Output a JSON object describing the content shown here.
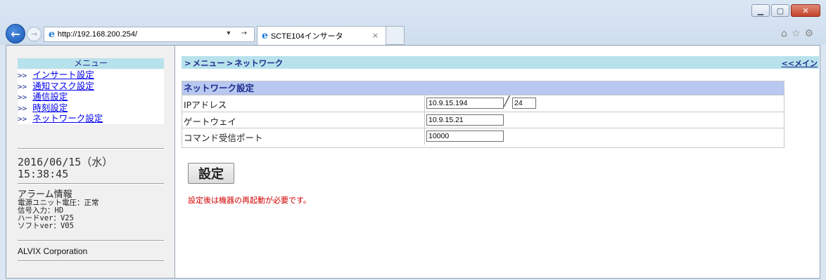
{
  "browser": {
    "url": "http://192.168.200.254/",
    "tab_title": "SCTE104インサータ",
    "addr_tools": "▾ →",
    "tab_close": "×"
  },
  "sidebar": {
    "menu_title": "メニュー",
    "items": [
      {
        "arrow": ">>",
        "label": "インサート設定"
      },
      {
        "arrow": ">>",
        "label": "通知マスク設定"
      },
      {
        "arrow": ">>",
        "label": "通信設定"
      },
      {
        "arrow": ">>",
        "label": "時刻設定"
      },
      {
        "arrow": ">>",
        "label": "ネットワーク設定"
      }
    ],
    "date": "2016/06/15（水）",
    "time": "15:38:45",
    "alarm_title": "アラーム情報",
    "alarm_lines": [
      "電源ユニット電圧：正常",
      "信号入力：HD",
      "ハードver：V25",
      "ソフトver：V05"
    ],
    "corp": "ALVIX Corporation"
  },
  "main": {
    "breadcrumb": [
      "メニュー",
      "ネットワーク"
    ],
    "breadcrumb_sep": ">",
    "back_link": "<<メイン",
    "panel_title": "ネットワーク設定",
    "rows": [
      {
        "label": "IPアドレス",
        "value": "10.9.15.194",
        "mask": "24"
      },
      {
        "label": "ゲートウェイ",
        "value": "10.9.15.21"
      },
      {
        "label": "コマンド受信ポート",
        "value": "10000"
      }
    ],
    "set_button": "設定",
    "warning": "設定後は機器の再起動が必要です。"
  }
}
